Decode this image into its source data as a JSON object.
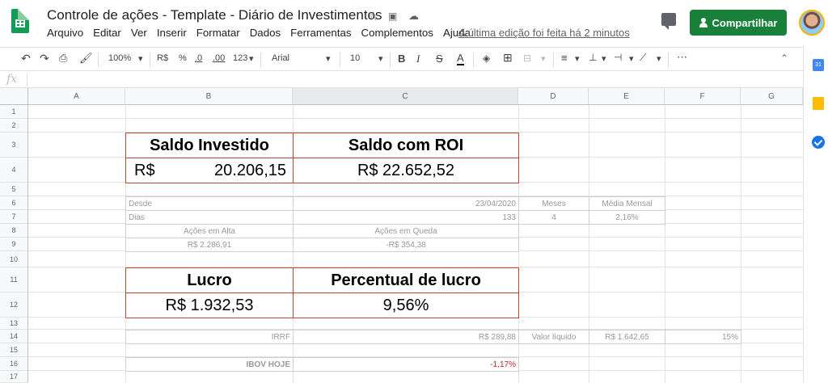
{
  "app": {
    "title": "Controle de ações - Template - Diário de Investimentos",
    "last_edit": "A última edição foi feita há 2 minutos",
    "share_label": "Compartilhar",
    "menu": [
      "Arquivo",
      "Editar",
      "Ver",
      "Inserir",
      "Formatar",
      "Dados",
      "Ferramentas",
      "Complementos",
      "Ajuda"
    ]
  },
  "toolbar": {
    "zoom": "100%",
    "currency": "R$",
    "percent": "%",
    "dec_less": ".0",
    "dec_more": ".00",
    "format_more": "123",
    "font": "Arial",
    "font_size": "10",
    "bold": "B",
    "italic": "I",
    "strike": "S",
    "text_color": "A",
    "more": "⋯"
  },
  "formula_bar": {
    "fx": "fx",
    "value": ""
  },
  "columns": [
    "A",
    "B",
    "C",
    "D",
    "E",
    "F",
    "G"
  ],
  "rows": [
    "1",
    "2",
    "3",
    "4",
    "5",
    "6",
    "7",
    "8",
    "9",
    "10",
    "11",
    "12",
    "13",
    "14",
    "15",
    "16",
    "17"
  ],
  "cells": {
    "saldo_investido_label": "Saldo Investido",
    "saldo_roi_label": "Saldo com ROI",
    "saldo_investido_currency": "R$",
    "saldo_investido_value": "20.206,15",
    "saldo_roi_value": "R$ 22.652,52",
    "desde_label": "Desde",
    "desde_value": "23/04/2020",
    "meses_label": "Meses",
    "media_mensal_label": "Média Mensal",
    "dias_label": "Dias",
    "dias_value": "133",
    "meses_value": "4",
    "media_mensal_value": "2,16%",
    "acoes_alta_label": "Ações em Alta",
    "acoes_queda_label": "Ações em Queda",
    "acoes_alta_value": "R$ 2.286,91",
    "acoes_queda_value": "-R$ 354,38",
    "lucro_label": "Lucro",
    "percentual_label": "Percentual de lucro",
    "lucro_value": "R$ 1.932,53",
    "percentual_value": "9,56%",
    "irrf_label": "IRRF",
    "irrf_value": "R$ 289,88",
    "valor_liquido_label": "Valor líquido",
    "valor_liquido_value": "R$ 1.642,65",
    "irrf_rate": "15%",
    "ibov_label": "IBOV HOJE",
    "ibov_value": "-1,17%"
  },
  "colors": {
    "share_button": "#188038",
    "box_border": "#c5452e",
    "negative_text": "#c5221f",
    "sheets_green": "#0f9d58"
  }
}
